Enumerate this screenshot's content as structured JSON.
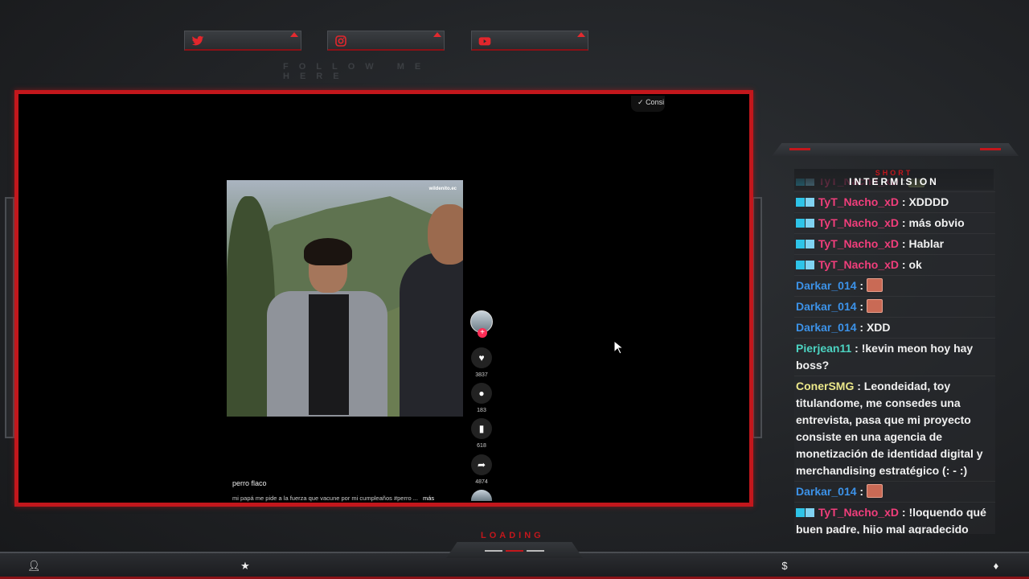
{
  "overlay": {
    "follow_text": "FOLLOW ME HERE",
    "social": [
      "twitter-icon",
      "instagram-icon",
      "youtube-icon"
    ],
    "loading_text": "LOADING",
    "chat_header_small": "SHORT",
    "chat_header_big": "INTERMISION",
    "accent_color": "#c3171c"
  },
  "video": {
    "top_pill_label": "Consi",
    "watermark": "wildenito.ec",
    "title": "perro flaco",
    "description": "mi papá me pide a la fuerza que vacune por mi cumpleaños #perro ...",
    "more_label": "más",
    "likes": "3837",
    "comments": "183",
    "saves": "618",
    "shares": "4874"
  },
  "chat": {
    "messages": [
      {
        "user": "TyT_Nacho_xD",
        "color": "#f03e7b",
        "badges": true,
        "text": "",
        "emote": "green"
      },
      {
        "user": "TyT_Nacho_xD",
        "color": "#f03e7b",
        "badges": true,
        "text": "XDDDD"
      },
      {
        "user": "TyT_Nacho_xD",
        "color": "#f03e7b",
        "badges": true,
        "text": "más obvio"
      },
      {
        "user": "TyT_Nacho_xD",
        "color": "#f03e7b",
        "badges": true,
        "text": "Hablar"
      },
      {
        "user": "TyT_Nacho_xD",
        "color": "#f03e7b",
        "badges": true,
        "text": "ok"
      },
      {
        "user": "Darkar_014",
        "color": "#3c92e8",
        "badges": false,
        "text": "",
        "emote": "red"
      },
      {
        "user": "Darkar_014",
        "color": "#3c92e8",
        "badges": false,
        "text": "",
        "emote": "red"
      },
      {
        "user": "Darkar_014",
        "color": "#3c92e8",
        "badges": false,
        "text": "XDD"
      },
      {
        "user": "Pierjean11",
        "color": "#4cd4c2",
        "badges": false,
        "text": "!kevin meon hoy hay boss?"
      },
      {
        "user": "ConerSMG",
        "color": "#ece88a",
        "badges": false,
        "text": "Leondeidad, toy titulandome, me consedes una entrevista, pasa que mi proyecto consiste en una agencia de monetización de identidad digital y merchandising estratégico (: - :)"
      },
      {
        "user": "Darkar_014",
        "color": "#3c92e8",
        "badges": false,
        "text": "",
        "emote": "red"
      },
      {
        "user": "TyT_Nacho_xD",
        "color": "#f03e7b",
        "badges": true,
        "text": "!loquendo qué buen padre, hijo mal agradecido"
      }
    ]
  }
}
